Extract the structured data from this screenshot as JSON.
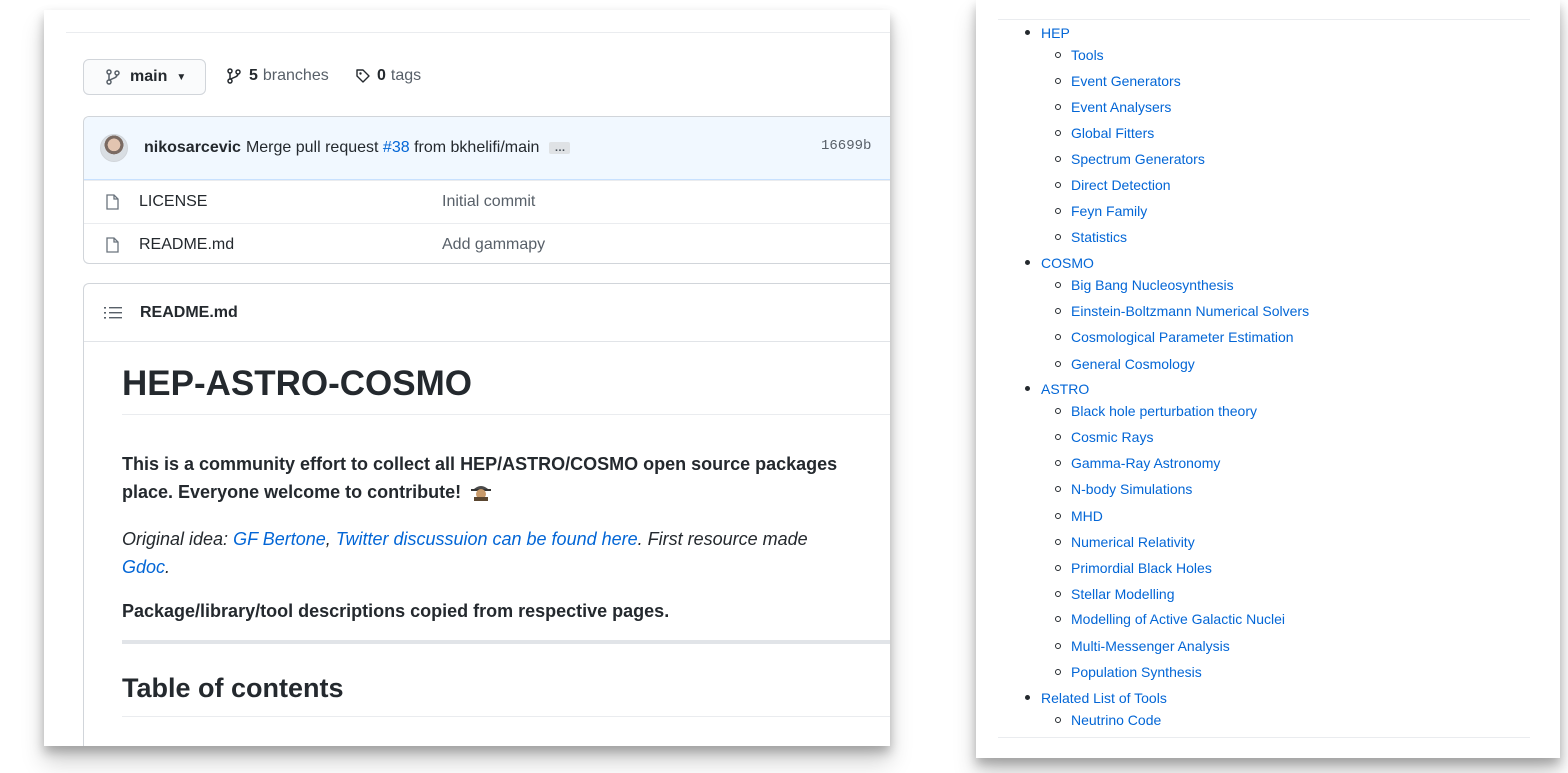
{
  "repo": {
    "branch_label": "main",
    "branches_count": "5",
    "branches_label": "branches",
    "tags_count": "0",
    "tags_label": "tags"
  },
  "commit": {
    "author": "nikosarcevic",
    "message_prefix": "Merge pull request",
    "pr_link": "#38",
    "message_suffix": "from bkhelifi/main",
    "ellipsis": "…",
    "sha": "16699b"
  },
  "files": [
    {
      "name": "LICENSE",
      "commit": "Initial commit"
    },
    {
      "name": "README.md",
      "commit": "Add gammapy"
    }
  ],
  "readme": {
    "header": "README.md",
    "title": "HEP-ASTRO-COSMO",
    "intro_line1": "This is a community effort to collect all HEP/ASTRO/COSMO open source packages",
    "intro_line2": "place. Everyone welcome to contribute!",
    "idea_prefix": "Original idea: ",
    "idea_link1": "GF Bertone",
    "idea_sep": ", ",
    "idea_link2": "Twitter discussuion can be found here",
    "idea_mid": ". First resource made",
    "idea_link3": "Gdoc",
    "idea_end": ".",
    "descriptions_note": "Package/library/tool descriptions copied from respective pages.",
    "toc_heading": "Table of contents"
  },
  "toc": [
    {
      "label": "HEP",
      "level": 1
    },
    {
      "label": "Tools",
      "level": 2
    },
    {
      "label": "Event Generators",
      "level": 2
    },
    {
      "label": "Event Analysers",
      "level": 2
    },
    {
      "label": "Global Fitters",
      "level": 2
    },
    {
      "label": "Spectrum Generators",
      "level": 2
    },
    {
      "label": "Direct Detection",
      "level": 2
    },
    {
      "label": "Feyn Family",
      "level": 2
    },
    {
      "label": "Statistics",
      "level": 2
    },
    {
      "label": "COSMO",
      "level": 1
    },
    {
      "label": "Big Bang Nucleosynthesis",
      "level": 2
    },
    {
      "label": "Einstein-Boltzmann Numerical Solvers",
      "level": 2
    },
    {
      "label": "Cosmological Parameter Estimation",
      "level": 2
    },
    {
      "label": "General Cosmology",
      "level": 2
    },
    {
      "label": "ASTRO",
      "level": 1
    },
    {
      "label": "Black hole perturbation theory",
      "level": 2
    },
    {
      "label": "Cosmic Rays",
      "level": 2
    },
    {
      "label": "Gamma-Ray Astronomy",
      "level": 2
    },
    {
      "label": "N-body Simulations",
      "level": 2
    },
    {
      "label": "MHD",
      "level": 2
    },
    {
      "label": "Numerical Relativity",
      "level": 2
    },
    {
      "label": "Primordial Black Holes",
      "level": 2
    },
    {
      "label": "Stellar Modelling",
      "level": 2
    },
    {
      "label": "Modelling of Active Galactic Nuclei",
      "level": 2
    },
    {
      "label": "Multi-Messenger Analysis",
      "level": 2
    },
    {
      "label": "Population Synthesis",
      "level": 2
    },
    {
      "label": "Related List of Tools",
      "level": 1
    },
    {
      "label": "Neutrino Code",
      "level": 2
    }
  ],
  "colors": {
    "link": "#0366d6",
    "text": "#24292e",
    "muted": "#586069",
    "commit_bg": "#f1f8ff"
  }
}
